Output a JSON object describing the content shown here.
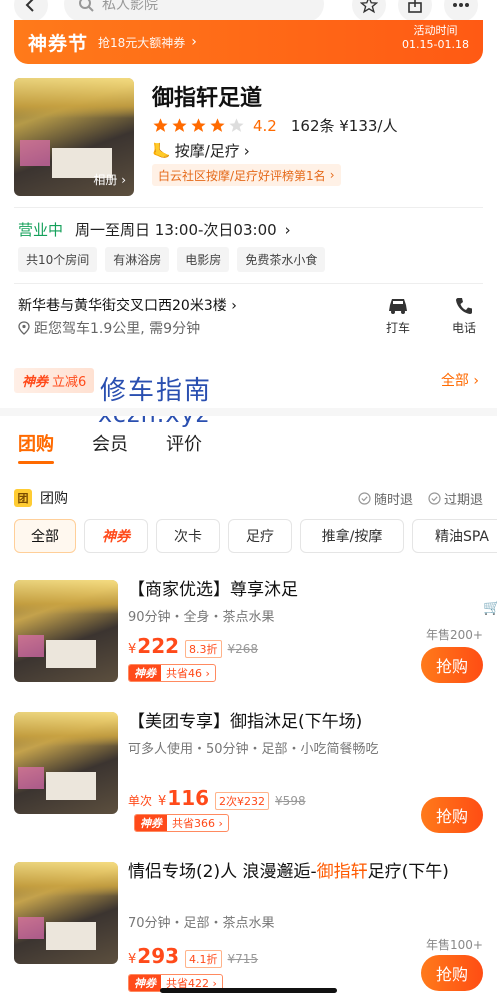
{
  "topbar": {
    "search_placeholder": "私人影院",
    "icons": [
      "back-icon",
      "search-icon",
      "star-icon",
      "share-icon",
      "more-icon"
    ]
  },
  "promo": {
    "title": "神券节",
    "subtitle": "抢18元大额神券",
    "time_label": "活动时间",
    "time_range": "01.15-01.18"
  },
  "shop": {
    "album_label": "相册",
    "name": "御指轩足道",
    "rating_score": "4.2",
    "stars_filled": 4,
    "stars_total": 5,
    "review_stats": "162条 ¥133/人",
    "category": "按摩/足疗",
    "rank_badge": "白云社区按摩/足疗好评榜第1名",
    "status": "营业中",
    "hours": "周一至周日 13:00-次日03:00",
    "facilities": [
      "共10个房间",
      "有淋浴房",
      "电影房",
      "免费茶水小食"
    ],
    "address": "新华巷与黄华街交叉口西20米3楼",
    "distance": "距您驾车1.9公里, 需9分钟",
    "action_taxi": "打车",
    "action_phone": "电话"
  },
  "coupon": {
    "badge": "神券",
    "discount": "立减6",
    "all_link": "全部"
  },
  "watermark": {
    "line1": "修车指南",
    "line2": "xczn.xyz"
  },
  "tabs": [
    "团购",
    "会员",
    "评价"
  ],
  "group_section": {
    "icon_text": "团",
    "label": "团购",
    "policy_1": "随时退",
    "policy_2": "过期退"
  },
  "filters": [
    "全部",
    "神券",
    "次卡",
    "足疗",
    "推拿/按摩",
    "精油SPA"
  ],
  "deals": [
    {
      "title": "【商家优选】尊享沐足",
      "title_highlight": "",
      "title_rest": "",
      "subtitle": "90分钟・全身・茶点水果",
      "price_prefix": "",
      "currency": "¥",
      "price": "222",
      "discount": "8.3折",
      "original": "¥268",
      "save_badge": "神券",
      "save_text": "共省46",
      "sold": "年售200+",
      "buy_label": "抢购"
    },
    {
      "title": "【美团专享】御指沐足(下午场)",
      "title_highlight": "",
      "title_rest": "",
      "subtitle": "可多人使用・50分钟・足部・小吃简餐畅吃",
      "price_prefix": "单次",
      "currency": "¥",
      "price": "116",
      "discount": "2次¥232",
      "original": "¥598",
      "save_badge": "神券",
      "save_text": "共省366",
      "sold": "",
      "buy_label": "抢购"
    },
    {
      "title": "情侣专场(2)人 浪漫邂逅-",
      "title_highlight": "御指轩",
      "title_rest": "足疗(下午)",
      "subtitle": "70分钟・足部・茶点水果",
      "price_prefix": "",
      "currency": "¥",
      "price": "293",
      "discount": "4.1折",
      "original": "¥715",
      "save_badge": "神券",
      "save_text": "共省422",
      "sold": "年售100+",
      "buy_label": "抢购"
    }
  ],
  "colors": {
    "accent": "#ff6a00",
    "price": "#ff4a1a",
    "open_status": "#14a05a",
    "watermark": "#2a4fb0"
  }
}
